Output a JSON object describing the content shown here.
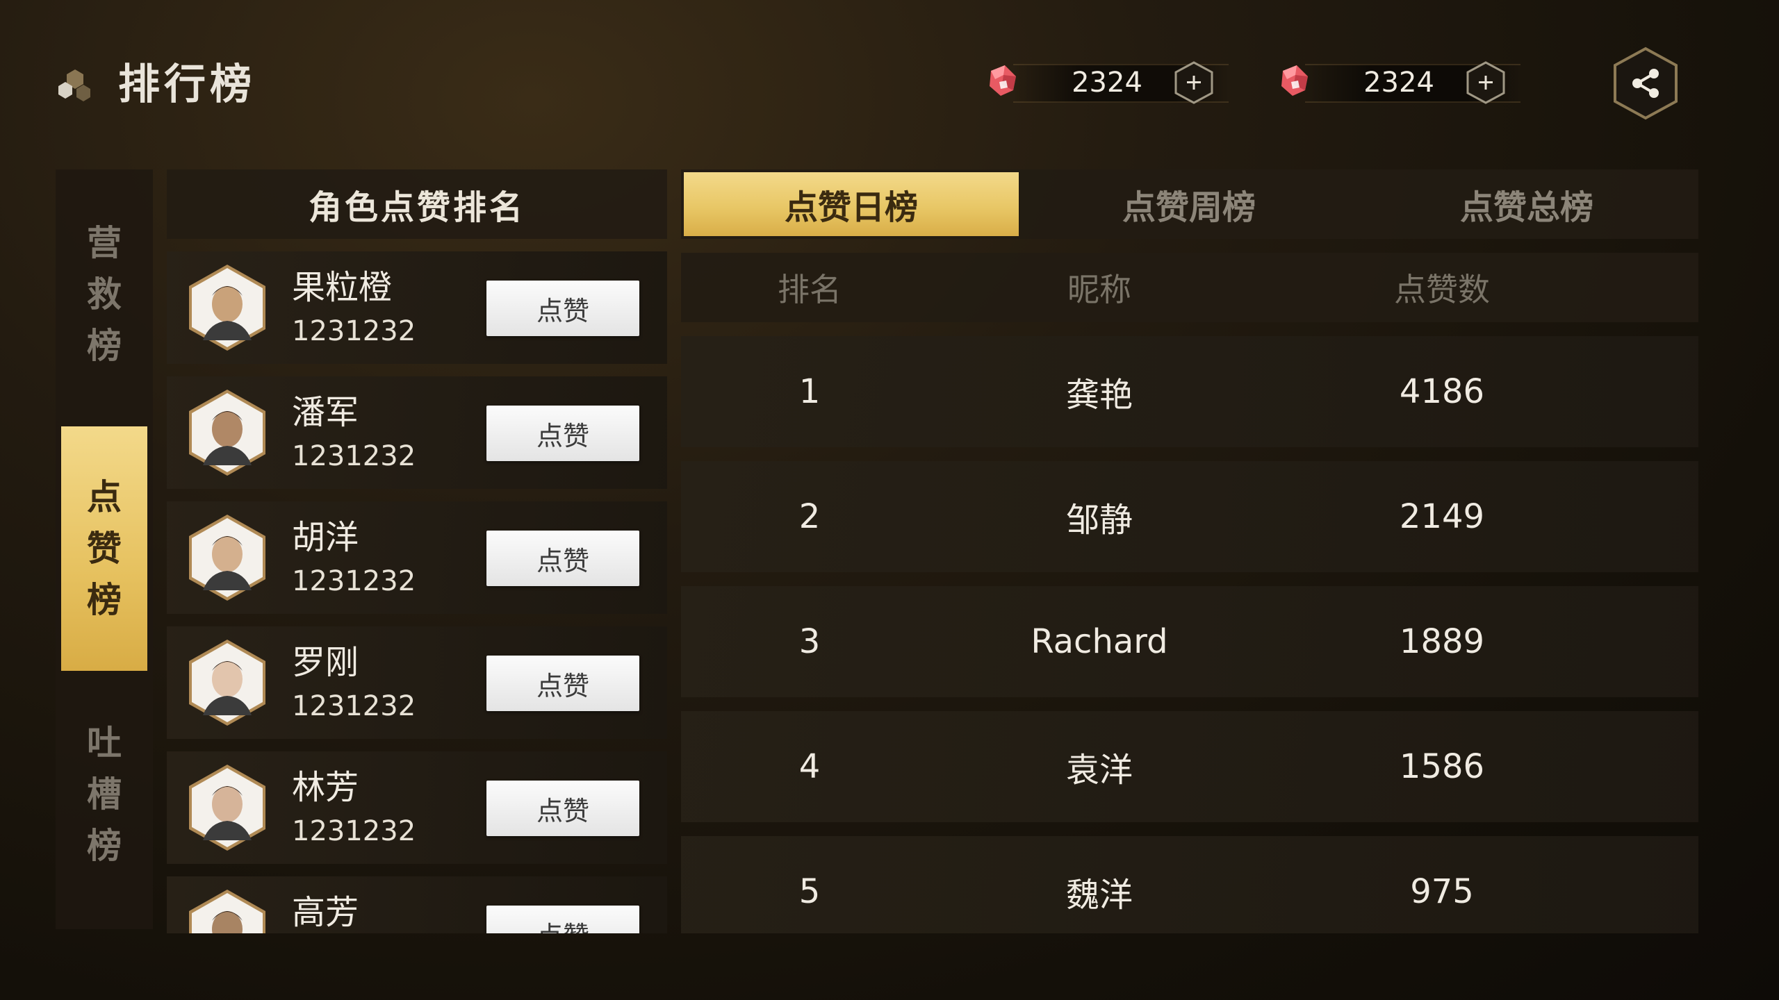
{
  "header": {
    "title": "排行榜",
    "logo_icon": "hexagon-cluster-icon",
    "currencies": [
      {
        "icon": "red-gem-icon",
        "amount": "2324",
        "add_icon": "plus-icon"
      },
      {
        "icon": "red-gem-icon",
        "amount": "2324",
        "add_icon": "plus-icon"
      }
    ],
    "share_icon": "share-icon"
  },
  "vertical_tabs": [
    {
      "chars": [
        "营",
        "救",
        "榜"
      ],
      "active": false
    },
    {
      "chars": [
        "点",
        "赞",
        "榜"
      ],
      "active": true
    },
    {
      "chars": [
        "吐",
        "槽",
        "榜"
      ],
      "active": false
    }
  ],
  "role_panel": {
    "title": "角色点赞排名",
    "like_label": "点赞",
    "roles": [
      {
        "name": "果粒橙",
        "score": "1231232",
        "avatar_icon": "avatar-male-icon"
      },
      {
        "name": "潘军",
        "score": "1231232",
        "avatar_icon": "avatar-male-icon"
      },
      {
        "name": "胡洋",
        "score": "1231232",
        "avatar_icon": "avatar-male-glasses-icon"
      },
      {
        "name": "罗刚",
        "score": "1231232",
        "avatar_icon": "avatar-female-glasses-icon"
      },
      {
        "name": "林芳",
        "score": "1231232",
        "avatar_icon": "avatar-female-icon"
      },
      {
        "name": "高芳",
        "score": "",
        "avatar_icon": "avatar-cap-icon"
      }
    ]
  },
  "ranking_tabs": [
    {
      "label": "点赞日榜",
      "active": true
    },
    {
      "label": "点赞周榜",
      "active": false
    },
    {
      "label": "点赞总榜",
      "active": false
    }
  ],
  "ranking_table": {
    "columns": [
      "排名",
      "昵称",
      "点赞数"
    ],
    "rows": [
      {
        "rank": "1",
        "nickname": "龚艳",
        "likes": "4186"
      },
      {
        "rank": "2",
        "nickname": "邹静",
        "likes": "2149"
      },
      {
        "rank": "3",
        "nickname": "Rachard",
        "likes": "1889"
      },
      {
        "rank": "4",
        "nickname": "袁洋",
        "likes": "1586"
      },
      {
        "rank": "5",
        "nickname": "魏洋",
        "likes": "975"
      }
    ]
  },
  "colors": {
    "accent_gold": "#e8c766",
    "background": "#1a140c",
    "gem_red": "#e8555f"
  }
}
